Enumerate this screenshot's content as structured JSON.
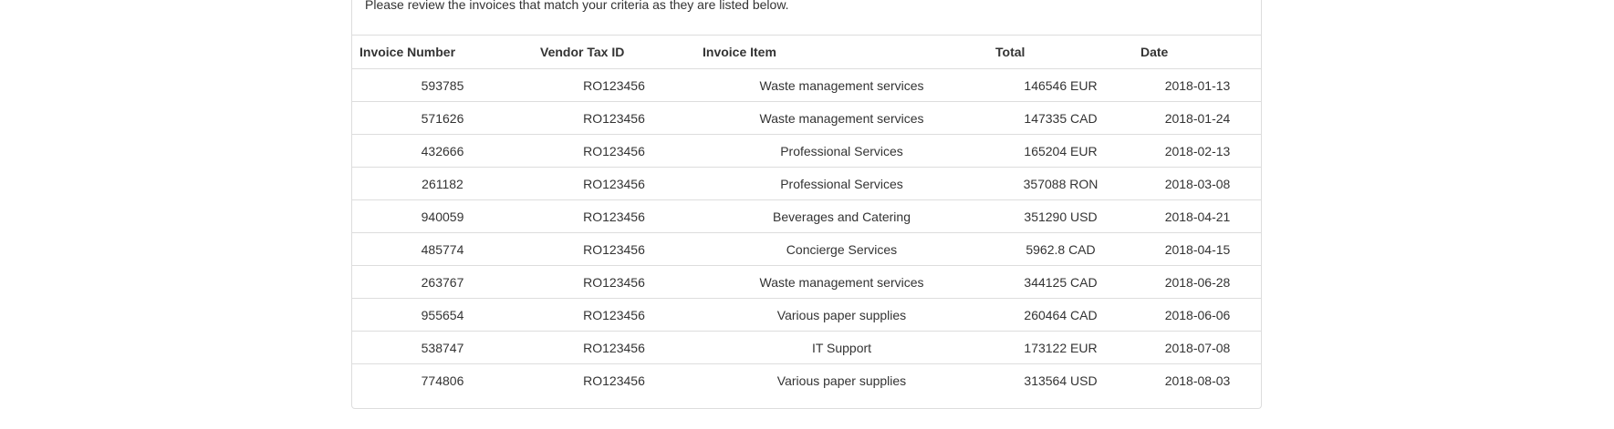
{
  "intro_text": "Please review the invoices that match your criteria as they are listed below.",
  "table": {
    "headers": {
      "invoice_number": "Invoice Number",
      "vendor_tax_id": "Vendor Tax ID",
      "invoice_item": "Invoice Item",
      "total": "Total",
      "date": "Date"
    },
    "rows": [
      {
        "invoice_number": "593785",
        "vendor_tax_id": "RO123456",
        "invoice_item": "Waste management services",
        "total": "146546 EUR",
        "date": "2018-01-13"
      },
      {
        "invoice_number": "571626",
        "vendor_tax_id": "RO123456",
        "invoice_item": "Waste management services",
        "total": "147335 CAD",
        "date": "2018-01-24"
      },
      {
        "invoice_number": "432666",
        "vendor_tax_id": "RO123456",
        "invoice_item": "Professional Services",
        "total": "165204 EUR",
        "date": "2018-02-13"
      },
      {
        "invoice_number": "261182",
        "vendor_tax_id": "RO123456",
        "invoice_item": "Professional Services",
        "total": "357088 RON",
        "date": "2018-03-08"
      },
      {
        "invoice_number": "940059",
        "vendor_tax_id": "RO123456",
        "invoice_item": "Beverages and Catering",
        "total": "351290 USD",
        "date": "2018-04-21"
      },
      {
        "invoice_number": "485774",
        "vendor_tax_id": "RO123456",
        "invoice_item": "Concierge Services",
        "total": "5962.8 CAD",
        "date": "2018-04-15"
      },
      {
        "invoice_number": "263767",
        "vendor_tax_id": "RO123456",
        "invoice_item": "Waste management services",
        "total": "344125 CAD",
        "date": "2018-06-28"
      },
      {
        "invoice_number": "955654",
        "vendor_tax_id": "RO123456",
        "invoice_item": "Various paper supplies",
        "total": "260464 CAD",
        "date": "2018-06-06"
      },
      {
        "invoice_number": "538747",
        "vendor_tax_id": "RO123456",
        "invoice_item": "IT Support",
        "total": "173122 EUR",
        "date": "2018-07-08"
      },
      {
        "invoice_number": "774806",
        "vendor_tax_id": "RO123456",
        "invoice_item": "Various paper supplies",
        "total": "313564 USD",
        "date": "2018-08-03"
      }
    ]
  }
}
